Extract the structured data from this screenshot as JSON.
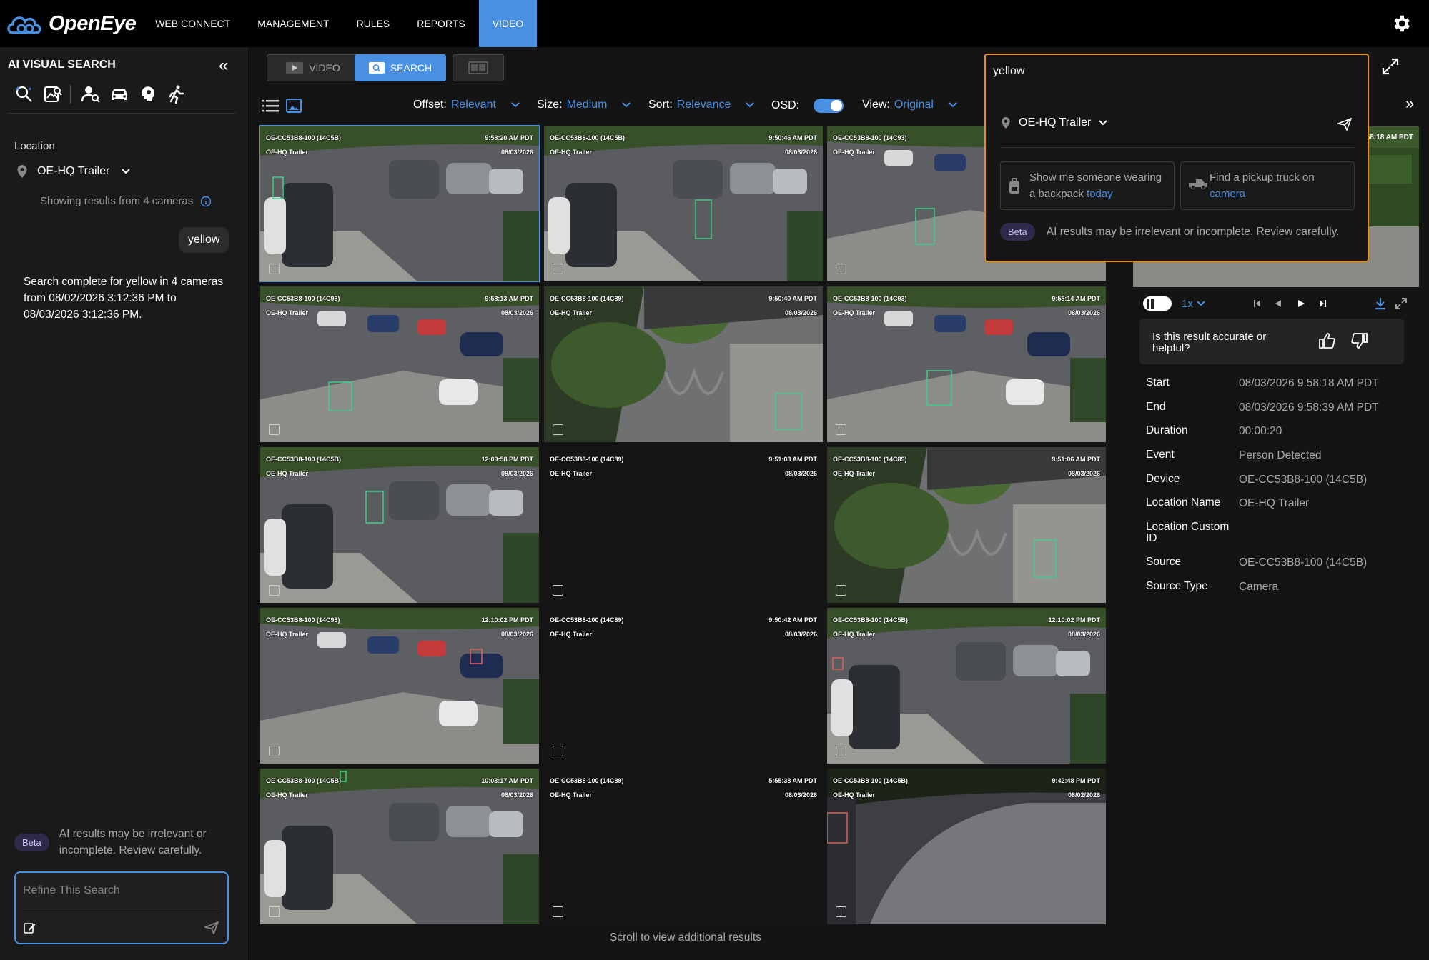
{
  "app": {
    "name": "OpenEye"
  },
  "nav": {
    "items": [
      "WEB CONNECT",
      "MANAGEMENT",
      "RULES",
      "REPORTS",
      "VIDEO"
    ],
    "active": "VIDEO"
  },
  "sidebar": {
    "title": "AI VISUAL SEARCH",
    "location_label": "Location",
    "location_value": "OE-HQ Trailer",
    "showing": "Showing results from 4 cameras",
    "query_bubble": "yellow",
    "complete": "Search complete for yellow in 4 cameras from 08/02/2026 3:12:36 PM to 08/03/2026 3:12:36 PM.",
    "beta_label": "Beta",
    "beta_text": "AI results may be irrelevant or incomplete. Review carefully.",
    "refine_placeholder": "Refine This Search"
  },
  "toolbar": {
    "video_label": "VIDEO",
    "search_label": "SEARCH",
    "offset_label": "Offset:",
    "offset_value": "Relevant",
    "size_label": "Size:",
    "size_value": "Medium",
    "sort_label": "Sort:",
    "sort_value": "Relevance",
    "osd_label": "OSD:",
    "view_label": "View:",
    "view_value": "Original"
  },
  "tiles": [
    {
      "camera": "OE-CC53B8-100 (14C5B)",
      "location": "OE-HQ Trailer",
      "time": "9:58:20 AM PDT",
      "date": "08/03/2026",
      "scene": "parking"
    },
    {
      "camera": "OE-CC53B8-100 (14C5B)",
      "location": "OE-HQ Trailer",
      "time": "9:50:46 AM PDT",
      "date": "08/03/2026",
      "scene": "parking"
    },
    {
      "camera": "OE-CC53B8-100 (14C93)",
      "location": "OE-HQ Trailer",
      "time": "",
      "date": "",
      "scene": "parking2"
    },
    {
      "camera": "OE-CC53B8-100 (14C93)",
      "location": "OE-HQ Trailer",
      "time": "9:58:13 AM PDT",
      "date": "08/03/2026",
      "scene": "parking2"
    },
    {
      "camera": "OE-CC53B8-100 (14C89)",
      "location": "OE-HQ Trailer",
      "time": "9:50:40 AM PDT",
      "date": "08/03/2026",
      "scene": "garden"
    },
    {
      "camera": "OE-CC53B8-100 (14C93)",
      "location": "OE-HQ Trailer",
      "time": "9:58:14 AM PDT",
      "date": "08/03/2026",
      "scene": "parking2"
    },
    {
      "camera": "OE-CC53B8-100 (14C5B)",
      "location": "OE-HQ Trailer",
      "time": "12:09:58 PM PDT",
      "date": "08/03/2026",
      "scene": "parking"
    },
    {
      "camera": "OE-CC53B8-100 (14C89)",
      "location": "OE-HQ Trailer",
      "time": "9:51:08 AM PDT",
      "date": "08/03/2026",
      "scene": "dark"
    },
    {
      "camera": "OE-CC53B8-100 (14C89)",
      "location": "OE-HQ Trailer",
      "time": "9:51:06 AM PDT",
      "date": "08/03/2026",
      "scene": "garden"
    },
    {
      "camera": "OE-CC53B8-100 (14C93)",
      "location": "OE-HQ Trailer",
      "time": "12:10:02 PM PDT",
      "date": "08/03/2026",
      "scene": "parking2"
    },
    {
      "camera": "OE-CC53B8-100 (14C89)",
      "location": "OE-HQ Trailer",
      "time": "9:50:42 AM PDT",
      "date": "08/03/2026",
      "scene": "dark"
    },
    {
      "camera": "OE-CC53B8-100 (14C5B)",
      "location": "OE-HQ Trailer",
      "time": "12:10:02 PM PDT",
      "date": "08/03/2026",
      "scene": "parking"
    },
    {
      "camera": "OE-CC53B8-100 (14C5B)",
      "location": "OE-HQ Trailer",
      "time": "10:03:17 AM PDT",
      "date": "08/03/2026",
      "scene": "parking"
    },
    {
      "camera": "OE-CC53B8-100 (14C89)",
      "location": "OE-HQ Trailer",
      "time": "5:55:38 AM PDT",
      "date": "08/03/2026",
      "scene": "dark"
    },
    {
      "camera": "OE-CC53B8-100 (14C5B)",
      "location": "OE-HQ Trailer",
      "time": "9:42:48 PM PDT",
      "date": "08/02/2026",
      "scene": "night"
    }
  ],
  "scroll_hint": "Scroll to view additional results",
  "query_panel": {
    "text": "yellow",
    "location": "OE-HQ Trailer",
    "sug1_a": "Show me someone wearing a backpack ",
    "sug1_b": "today",
    "sug2_a": "Find a pickup truck on ",
    "sug2_b": "camera",
    "beta_label": "Beta",
    "beta_text": "AI results may be irrelevant or incomplete. Review carefully."
  },
  "preview": {
    "time": "9:58:18 AM PDT",
    "speed": "1x"
  },
  "feedback": {
    "question": "Is this result accurate or helpful?"
  },
  "details": [
    {
      "key": "Start",
      "value": "08/03/2026 9:58:18 AM PDT"
    },
    {
      "key": "End",
      "value": "08/03/2026 9:58:39 AM PDT"
    },
    {
      "key": "Duration",
      "value": "00:00:20"
    },
    {
      "key": "Event",
      "value": "Person Detected"
    },
    {
      "key": "Device",
      "value": "OE-CC53B8-100 (14C5B)"
    },
    {
      "key": "Location Name",
      "value": "OE-HQ Trailer"
    },
    {
      "key": "Location Custom ID",
      "value": ""
    },
    {
      "key": "Source",
      "value": "OE-CC53B8-100 (14C5B)"
    },
    {
      "key": "Source Type",
      "value": "Camera"
    }
  ],
  "colors": {
    "accent": "#4a90e2",
    "query_border": "#e8900c",
    "detect_green": "#3fcf8e",
    "detect_red": "#e06060"
  }
}
